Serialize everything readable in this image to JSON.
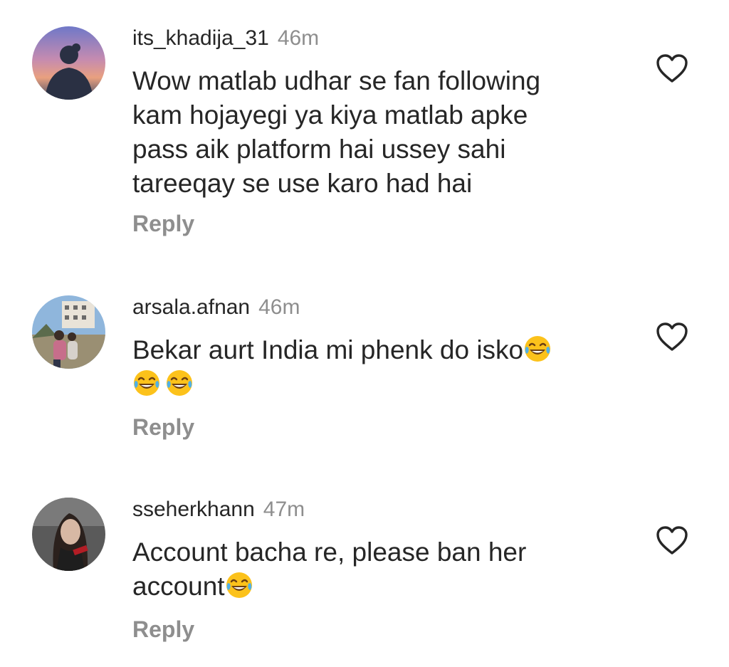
{
  "comments": [
    {
      "username": "its_khadija_31",
      "time": "46m",
      "lines": [
        "Wow matlab udhar se fan following",
        "kam hojayegi ya kiya matlab apke",
        "pass aik platform hai ussey sahi",
        "tareeqay se use karo had hai"
      ],
      "reply_label": "Reply",
      "like_icon": "heart-outline-icon"
    },
    {
      "username": "arsala.afnan",
      "time": "46m",
      "lines": [
        "Bekar aurt India mi phenk do isko"
      ],
      "emojis_after_line": "face-with-tears-of-joy",
      "emoji_row_count": 2,
      "reply_label": "Reply",
      "like_icon": "heart-outline-icon"
    },
    {
      "username": "sseherkhann",
      "time": "47m",
      "lines": [
        "Account bacha re, please ban her",
        "account"
      ],
      "emojis_after_line": "face-with-tears-of-joy",
      "reply_label": "Reply",
      "like_icon": "heart-outline-icon"
    }
  ],
  "colors": {
    "text": "#262626",
    "secondary": "#8e8e8e",
    "background": "#ffffff"
  }
}
